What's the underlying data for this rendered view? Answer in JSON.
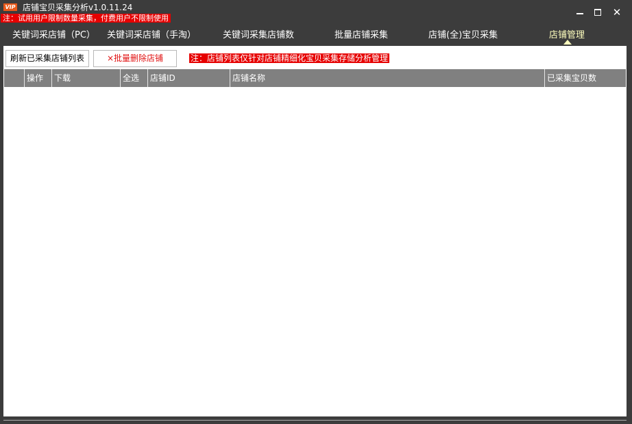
{
  "window": {
    "logo_text": "VIP",
    "title": "店铺宝贝采集分析v1.0.11.24",
    "notice": "注：试用用户限制数量采集，付费用户不限制使用",
    "controls": {
      "minimize_icon": "minimize-icon",
      "maximize_icon": "maximize-icon",
      "close_symbol": "✕"
    }
  },
  "tabs": [
    {
      "label": "关键词采店铺（PC）"
    },
    {
      "label": "关键词采店铺（手淘）"
    },
    {
      "label": "关键词采集店铺数"
    },
    {
      "label": "批量店铺采集"
    },
    {
      "label": "店铺(全)宝贝采集"
    },
    {
      "label": "店铺管理",
      "active": true
    }
  ],
  "toolbar": {
    "refresh_label": "刷新已采集店铺列表",
    "delete_label": "×批量删除店铺",
    "note": "注：店铺列表仅针对店铺精细化宝贝采集存储分析管理"
  },
  "table": {
    "columns": [
      "",
      "操作",
      "下载",
      "全选",
      "店铺ID",
      "店铺名称",
      "已采集宝贝数"
    ],
    "rows": []
  },
  "colors": {
    "frame": "#3c3c3c",
    "header_bg": "#808080",
    "notice_red": "#e60000",
    "active_tab": "#ffffbf",
    "delete_text": "#e01010"
  }
}
